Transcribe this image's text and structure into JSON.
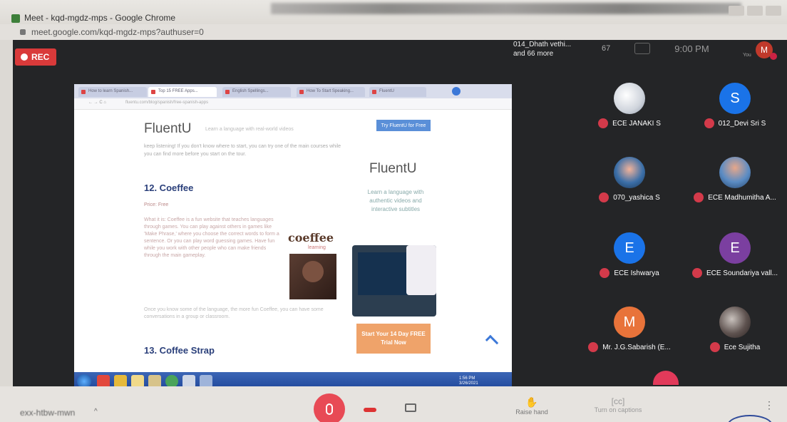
{
  "window": {
    "title": "Meet - kqd-mgdz-mps - Google Chrome"
  },
  "address": {
    "url": "meet.google.com/kqd-mgdz-mps?authuser=0"
  },
  "recording": {
    "label": "REC"
  },
  "top": {
    "participants_summary_line1": "014_Dhath vethi...",
    "participants_summary_line2": "and 66 more",
    "people_count": "67",
    "chat_label": "(+)",
    "clock": "9:00 PM",
    "you_label": "You",
    "avatar_letter": "M"
  },
  "shared_screen": {
    "tabs": [
      "How to learn Spanish...",
      "Top 15 FREE Apps...",
      "English Spellings...",
      "How To Start Speaking...",
      "FluentU"
    ],
    "nav_buttons": "← → C ⌂",
    "page_url": "fluentu.com/blog/spanish/free-spanish-apps",
    "brand": "FluentU",
    "brand_slogan": "Learn a language with real-world videos",
    "try_button": "Try FluentU for Free",
    "intro_text": "keep listening! If you don't know where to start, you can try one of the main courses while you can find more before you start on the tour.",
    "heading_12": "12. Coeffee",
    "price": "Price: Free",
    "body_text": "What it is: Coeffee is a fun website that teaches languages through games. You can play against others in games like 'Make Phrase,' where you choose the correct words to form a sentence. Or you can play word guessing games. Have fun while you work with other people who can make friends through the main gameplay.",
    "body_text_2": "Once you know some of the language, the more fun Coeffee, you can have some conversations in a group or classroom.",
    "heading_13": "13. Coffee Strap",
    "coeffee_logo": "coeffee",
    "coeffee_sub": "learning",
    "ad_brand": "FluentU",
    "ad_text": "Learn a language with authentic videos and interactive subtitles",
    "ad_cta": "Start Your 14 Day FREE Trial Now",
    "tray_time": "1:56 PM",
    "tray_date": "3/26/2021"
  },
  "participants": [
    {
      "name": "ECE JANAKI S",
      "letter": "",
      "color": ""
    },
    {
      "name": "012_Devi Sri S",
      "letter": "S",
      "color": "#1a73e8"
    },
    {
      "name": "070_yashica S",
      "letter": "",
      "color": ""
    },
    {
      "name": "ECE Madhumitha A...",
      "letter": "",
      "color": ""
    },
    {
      "name": "ECE Ishwarya",
      "letter": "E",
      "color": "#1a73e8"
    },
    {
      "name": "ECE Soundariya vall...",
      "letter": "E",
      "color": "#7b3fa0"
    },
    {
      "name": "Mr. J.G.Sabarish (E...",
      "letter": "M",
      "color": "#e8733a"
    },
    {
      "name": "Ece Sujitha",
      "letter": "",
      "color": ""
    }
  ],
  "bottom": {
    "meeting_code": "exx-htbw-mwn",
    "chevron": "^",
    "raise_hand": "Raise hand",
    "captions": "Turn on captions",
    "more": "⋮"
  }
}
